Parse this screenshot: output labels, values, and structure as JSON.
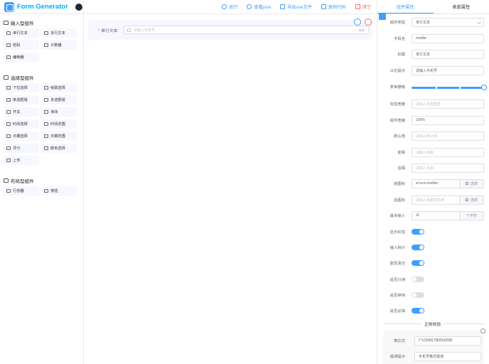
{
  "app": {
    "title": "Form Generator"
  },
  "toolbar": {
    "run": "运行",
    "view_json": "查看json",
    "export_vue": "导出vue文件",
    "copy_code": "复制代码",
    "clear": "清空"
  },
  "left": {
    "groups": [
      {
        "title": "输入型组件",
        "items": [
          "单行文本",
          "多行文本",
          "密码",
          "计数器",
          "编辑器"
        ]
      },
      {
        "title": "选择型组件",
        "items": [
          "下拉选择",
          "级联选择",
          "单选框组",
          "多选框组",
          "开关",
          "滑块",
          "时间选择",
          "时间范围",
          "日期选择",
          "日期范围",
          "评分",
          "颜色选择",
          "上传"
        ]
      },
      {
        "title": "布局型组件",
        "items": [
          "行容器",
          "按钮"
        ]
      }
    ]
  },
  "canvas": {
    "field": {
      "label": "单行文本",
      "placeholder": "请输入手机号",
      "counter": "0/11"
    }
  },
  "right": {
    "tabs": {
      "component": "组件属性",
      "form": "表单属性"
    },
    "props": {
      "type_label": "组件类型",
      "type_value": "单行文本",
      "field_label": "字段名",
      "field_value": "mobile",
      "title_label": "标题",
      "title_value": "单行文本",
      "placeholder_label": "占位提示",
      "placeholder_value": "请输入手机号",
      "grid_label": "表单栅格",
      "label_width_label": "标签宽度",
      "label_width_ph": "请输入标签宽度",
      "comp_width_label": "组件宽度",
      "comp_width_value": "100%",
      "default_label": "默认值",
      "default_ph": "请输入默认值",
      "prefix_label": "前缀",
      "prefix_ph": "请输入前缀",
      "suffix_label": "后缀",
      "suffix_ph": "请输入后缀",
      "prefix_icon_label": "前图标",
      "prefix_icon_value": "el-icon-mobile",
      "suffix_icon_label": "后图标",
      "suffix_icon_ph": "请输入后图标名称",
      "choose": "选择",
      "maxlen_label": "最多输入",
      "maxlen_value": "11",
      "maxlen_unit": "个字符",
      "show_label": "显示标签",
      "word_limit": "输入统计",
      "clearable": "能否清空",
      "readonly": "是否只读",
      "disabled": "是否禁用",
      "required": "是否必填"
    },
    "regex": {
      "title": "正则校验",
      "expr_label": "表达式",
      "expr_value": "/^1(3|4|5|7|8|9)\\d{9}$/",
      "msg_label": "错误提示",
      "msg_value": "手机号格式错误"
    }
  }
}
